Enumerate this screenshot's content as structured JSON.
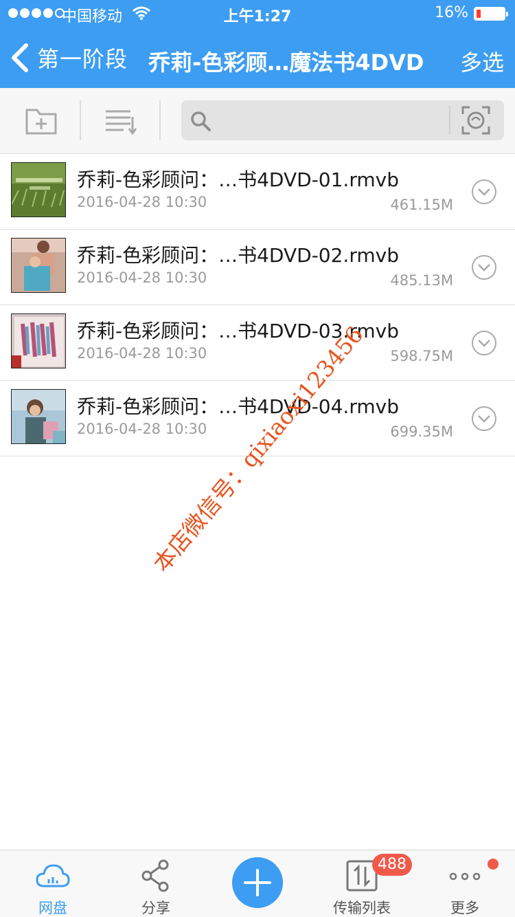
{
  "status_bar": {
    "carrier": "中国移动",
    "time": "上午1:27",
    "battery_percent": "16%",
    "battery_level": 0.16
  },
  "nav": {
    "back_label": "第一阶段",
    "title": "乔莉-色彩顾…魔法书4DVD",
    "select_label": "多选"
  },
  "toolbar": {
    "new_folder_icon": "folder-add-icon",
    "sort_icon": "sort-list-icon",
    "search_placeholder": "",
    "scan_icon": "scan-icon"
  },
  "files": [
    {
      "name": "乔莉-色彩顾问：…书4DVD-01.rmvb",
      "date": "2016-04-28 10:30",
      "size": "461.15M"
    },
    {
      "name": "乔莉-色彩顾问：…书4DVD-02.rmvb",
      "date": "2016-04-28 10:30",
      "size": "485.13M"
    },
    {
      "name": "乔莉-色彩顾问：…书4DVD-03.rmvb",
      "date": "2016-04-28 10:30",
      "size": "598.75M"
    },
    {
      "name": "乔莉-色彩顾问：…书4DVD-04.rmvb",
      "date": "2016-04-28 10:30",
      "size": "699.35M"
    }
  ],
  "watermark": "本店微信号：qixiaoxi123456",
  "tabs": [
    {
      "label": "网盘",
      "icon": "cloud-icon",
      "active": true
    },
    {
      "label": "分享",
      "icon": "share-icon",
      "active": false
    },
    {
      "label": "",
      "icon": "plus-icon",
      "active": false
    },
    {
      "label": "传输列表",
      "icon": "transfer-icon",
      "active": false,
      "badge": "488"
    },
    {
      "label": "更多",
      "icon": "more-icon",
      "active": false,
      "dot": true
    }
  ],
  "colors": {
    "accent": "#3d9df2",
    "badge": "#f15a4a",
    "watermark": "#e9531e"
  }
}
